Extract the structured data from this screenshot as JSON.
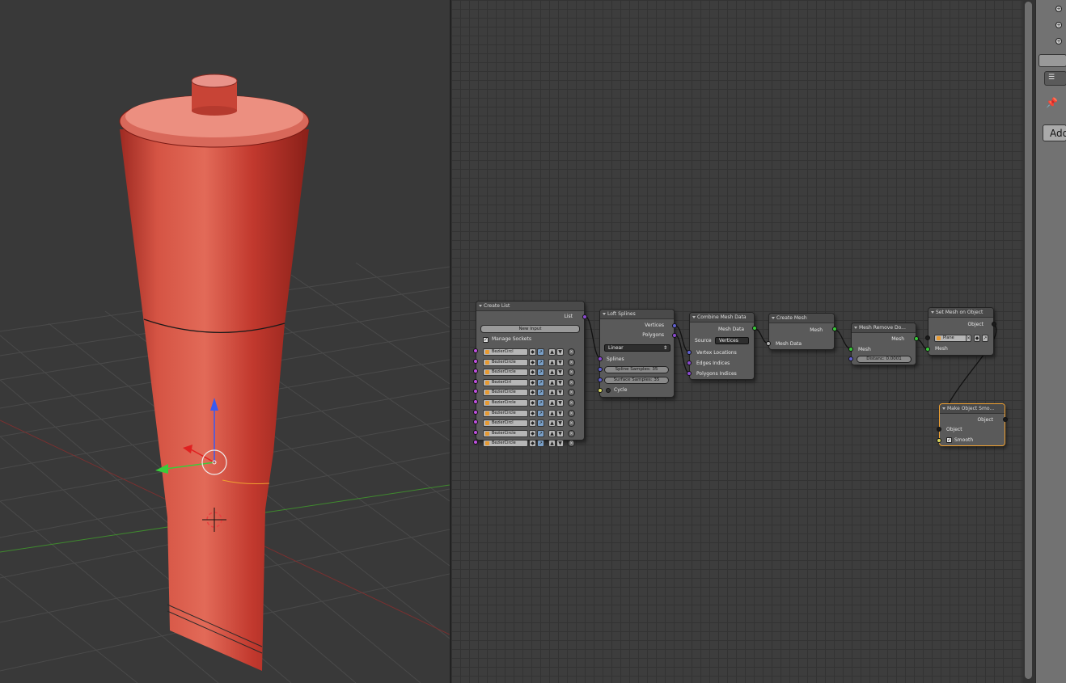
{
  "nodes": {
    "create_list": {
      "title": "Create List",
      "output": "List",
      "new_input": "New Input",
      "manage_sockets": "Manage Sockets",
      "items": [
        "BezierCircl",
        "BezierCircle",
        "BezierCircle",
        "BezierCirl",
        "BezierCircle",
        "BezierCircle",
        "BezierCircle",
        "BezierCircl",
        "BezierCircle",
        "BezierCircle"
      ]
    },
    "loft_splines": {
      "title": "Loft Splines",
      "out_vertices": "Vertices",
      "out_polygons": "Polygons",
      "interpolation": "Linear",
      "in_splines": "Splines",
      "spline_samples": "Spline Samples: 35",
      "surface_samples": "Surface Samples: 35",
      "cycle": "Cycle"
    },
    "combine_mesh": {
      "title": "Combine Mesh Data",
      "out_mesh_data": "Mesh Data",
      "source_label": "Source",
      "source_value": "Vertices and",
      "in_vertex_locations": "Vertex Locations",
      "in_edges": "Edges Indices",
      "in_polygons": "Polygons Indices"
    },
    "create_mesh": {
      "title": "Create Mesh",
      "out_mesh": "Mesh",
      "in_mesh_data": "Mesh Data"
    },
    "mesh_remove": {
      "title": "Mesh Remove Do...",
      "out_mesh": "Mesh",
      "in_mesh": "Mesh",
      "distance": "Distanc: 0.0001"
    },
    "set_mesh": {
      "title": "Set Mesh on Object",
      "out_object": "Object",
      "object_value": "Plane",
      "in_mesh": "Mesh"
    },
    "make_smooth": {
      "title": "Make Object Smo...",
      "out_object": "Object",
      "in_object": "Object",
      "smooth": "Smooth"
    }
  },
  "sidebar": {
    "add_label": "Add"
  },
  "colors": {
    "viewport_bg": "#393939",
    "mesh": "#c8453a",
    "node_body": "#5a5a5a",
    "active_outline": "#f0a030",
    "socket_vector": "#6060d0",
    "socket_list": "#8a4ad0",
    "socket_object": "#1a1a1a",
    "socket_mesh": "#39c839",
    "socket_purple": "#c050e0"
  }
}
